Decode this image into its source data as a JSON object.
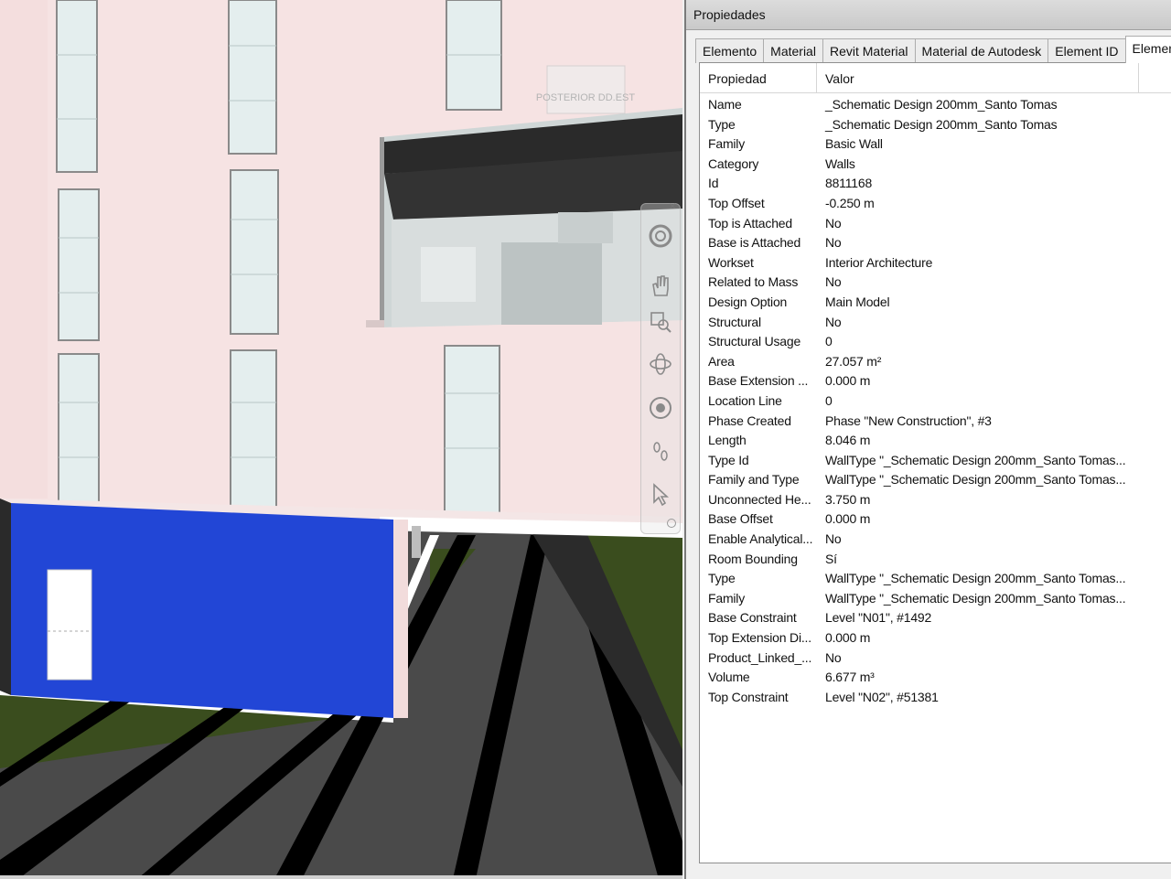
{
  "panel": {
    "title": "Propiedades",
    "tabs": [
      {
        "label": "Elemento"
      },
      {
        "label": "Material"
      },
      {
        "label": "Revit Material"
      },
      {
        "label": "Material de Autodesk"
      },
      {
        "label": "Element ID"
      },
      {
        "label": "Element"
      }
    ],
    "active_tab": "Element",
    "headers": {
      "property": "Propiedad",
      "value": "Valor"
    },
    "rows": [
      {
        "k": "Name",
        "v": "_Schematic Design 200mm_Santo Tomas"
      },
      {
        "k": "Type",
        "v": "_Schematic Design 200mm_Santo Tomas"
      },
      {
        "k": "Family",
        "v": "Basic Wall"
      },
      {
        "k": "Category",
        "v": "Walls"
      },
      {
        "k": "Id",
        "v": "8811168"
      },
      {
        "k": "Top Offset",
        "v": "-0.250 m"
      },
      {
        "k": "Top is Attached",
        "v": "No"
      },
      {
        "k": "Base is Attached",
        "v": "No"
      },
      {
        "k": "Workset",
        "v": "Interior Architecture"
      },
      {
        "k": "Related to Mass",
        "v": "No"
      },
      {
        "k": "Design Option",
        "v": "Main Model"
      },
      {
        "k": "Structural",
        "v": "No"
      },
      {
        "k": "Structural Usage",
        "v": "0"
      },
      {
        "k": "Area",
        "v": "27.057 m²"
      },
      {
        "k": "Base Extension ...",
        "v": "0.000 m"
      },
      {
        "k": "Location Line",
        "v": "0"
      },
      {
        "k": "Phase Created",
        "v": "Phase \"New Construction\", #3"
      },
      {
        "k": "Length",
        "v": "8.046 m"
      },
      {
        "k": "Type Id",
        "v": "WallType \"_Schematic Design 200mm_Santo Tomas..."
      },
      {
        "k": "Family and Type",
        "v": "WallType \"_Schematic Design 200mm_Santo Tomas..."
      },
      {
        "k": "Unconnected He...",
        "v": "3.750 m"
      },
      {
        "k": "Base Offset",
        "v": "0.000 m"
      },
      {
        "k": "Enable Analytical...",
        "v": "No"
      },
      {
        "k": "Room Bounding",
        "v": "Sí"
      },
      {
        "k": "Type",
        "v": "WallType \"_Schematic Design 200mm_Santo Tomas..."
      },
      {
        "k": "Family",
        "v": "WallType \"_Schematic Design 200mm_Santo Tomas..."
      },
      {
        "k": "Base Constraint",
        "v": "Level \"N01\", #1492"
      },
      {
        "k": "Top Extension Di...",
        "v": "0.000 m"
      },
      {
        "k": "Product_Linked_...",
        "v": "No"
      },
      {
        "k": "Volume",
        "v": "6.677 m³"
      },
      {
        "k": "Top Constraint",
        "v": "Level \"N02\", #51381"
      }
    ]
  },
  "viewport": {
    "signage_text": "POSTERIOR DD.EST",
    "colors": {
      "facade": "#f6e3e3",
      "selected_wall": "#2246d6",
      "road": "#4a4a4a",
      "grass": "#3a4d1e",
      "glass": "#e4eeee"
    },
    "nav_icons": [
      "steering-wheel-icon",
      "pan-hand-icon",
      "zoom-window-icon",
      "orbit-icon",
      "look-eye-icon",
      "walk-footsteps-icon",
      "select-cursor-icon"
    ]
  }
}
